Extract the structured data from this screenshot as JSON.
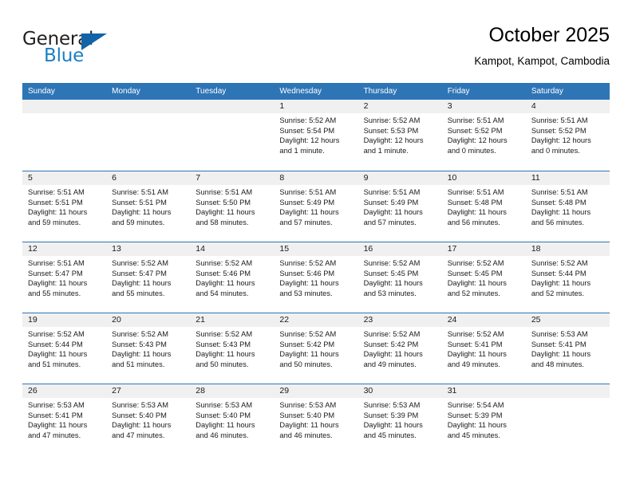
{
  "brand": {
    "name_part1": "General",
    "name_part2": "Blue",
    "triangle_icon": "blue-triangle-icon",
    "accent_color": "#1b7fc4"
  },
  "header": {
    "title": "October 2025",
    "subtitle": "Kampot, Kampot, Cambodia"
  },
  "theme": {
    "header_blue": "#2e75b6",
    "day_strip_gray": "#f0f0f0",
    "text_color": "#1a1a1a"
  },
  "calendar": {
    "weekdays": [
      "Sunday",
      "Monday",
      "Tuesday",
      "Wednesday",
      "Thursday",
      "Friday",
      "Saturday"
    ],
    "weeks": [
      [
        {
          "day": "",
          "empty": true
        },
        {
          "day": "",
          "empty": true
        },
        {
          "day": "",
          "empty": true
        },
        {
          "day": "1",
          "sunrise": "Sunrise: 5:52 AM",
          "sunset": "Sunset: 5:54 PM",
          "daylight_line1": "Daylight: 12 hours",
          "daylight_line2": "and 1 minute."
        },
        {
          "day": "2",
          "sunrise": "Sunrise: 5:52 AM",
          "sunset": "Sunset: 5:53 PM",
          "daylight_line1": "Daylight: 12 hours",
          "daylight_line2": "and 1 minute."
        },
        {
          "day": "3",
          "sunrise": "Sunrise: 5:51 AM",
          "sunset": "Sunset: 5:52 PM",
          "daylight_line1": "Daylight: 12 hours",
          "daylight_line2": "and 0 minutes."
        },
        {
          "day": "4",
          "sunrise": "Sunrise: 5:51 AM",
          "sunset": "Sunset: 5:52 PM",
          "daylight_line1": "Daylight: 12 hours",
          "daylight_line2": "and 0 minutes."
        }
      ],
      [
        {
          "day": "5",
          "sunrise": "Sunrise: 5:51 AM",
          "sunset": "Sunset: 5:51 PM",
          "daylight_line1": "Daylight: 11 hours",
          "daylight_line2": "and 59 minutes."
        },
        {
          "day": "6",
          "sunrise": "Sunrise: 5:51 AM",
          "sunset": "Sunset: 5:51 PM",
          "daylight_line1": "Daylight: 11 hours",
          "daylight_line2": "and 59 minutes."
        },
        {
          "day": "7",
          "sunrise": "Sunrise: 5:51 AM",
          "sunset": "Sunset: 5:50 PM",
          "daylight_line1": "Daylight: 11 hours",
          "daylight_line2": "and 58 minutes."
        },
        {
          "day": "8",
          "sunrise": "Sunrise: 5:51 AM",
          "sunset": "Sunset: 5:49 PM",
          "daylight_line1": "Daylight: 11 hours",
          "daylight_line2": "and 57 minutes."
        },
        {
          "day": "9",
          "sunrise": "Sunrise: 5:51 AM",
          "sunset": "Sunset: 5:49 PM",
          "daylight_line1": "Daylight: 11 hours",
          "daylight_line2": "and 57 minutes."
        },
        {
          "day": "10",
          "sunrise": "Sunrise: 5:51 AM",
          "sunset": "Sunset: 5:48 PM",
          "daylight_line1": "Daylight: 11 hours",
          "daylight_line2": "and 56 minutes."
        },
        {
          "day": "11",
          "sunrise": "Sunrise: 5:51 AM",
          "sunset": "Sunset: 5:48 PM",
          "daylight_line1": "Daylight: 11 hours",
          "daylight_line2": "and 56 minutes."
        }
      ],
      [
        {
          "day": "12",
          "sunrise": "Sunrise: 5:51 AM",
          "sunset": "Sunset: 5:47 PM",
          "daylight_line1": "Daylight: 11 hours",
          "daylight_line2": "and 55 minutes."
        },
        {
          "day": "13",
          "sunrise": "Sunrise: 5:52 AM",
          "sunset": "Sunset: 5:47 PM",
          "daylight_line1": "Daylight: 11 hours",
          "daylight_line2": "and 55 minutes."
        },
        {
          "day": "14",
          "sunrise": "Sunrise: 5:52 AM",
          "sunset": "Sunset: 5:46 PM",
          "daylight_line1": "Daylight: 11 hours",
          "daylight_line2": "and 54 minutes."
        },
        {
          "day": "15",
          "sunrise": "Sunrise: 5:52 AM",
          "sunset": "Sunset: 5:46 PM",
          "daylight_line1": "Daylight: 11 hours",
          "daylight_line2": "and 53 minutes."
        },
        {
          "day": "16",
          "sunrise": "Sunrise: 5:52 AM",
          "sunset": "Sunset: 5:45 PM",
          "daylight_line1": "Daylight: 11 hours",
          "daylight_line2": "and 53 minutes."
        },
        {
          "day": "17",
          "sunrise": "Sunrise: 5:52 AM",
          "sunset": "Sunset: 5:45 PM",
          "daylight_line1": "Daylight: 11 hours",
          "daylight_line2": "and 52 minutes."
        },
        {
          "day": "18",
          "sunrise": "Sunrise: 5:52 AM",
          "sunset": "Sunset: 5:44 PM",
          "daylight_line1": "Daylight: 11 hours",
          "daylight_line2": "and 52 minutes."
        }
      ],
      [
        {
          "day": "19",
          "sunrise": "Sunrise: 5:52 AM",
          "sunset": "Sunset: 5:44 PM",
          "daylight_line1": "Daylight: 11 hours",
          "daylight_line2": "and 51 minutes."
        },
        {
          "day": "20",
          "sunrise": "Sunrise: 5:52 AM",
          "sunset": "Sunset: 5:43 PM",
          "daylight_line1": "Daylight: 11 hours",
          "daylight_line2": "and 51 minutes."
        },
        {
          "day": "21",
          "sunrise": "Sunrise: 5:52 AM",
          "sunset": "Sunset: 5:43 PM",
          "daylight_line1": "Daylight: 11 hours",
          "daylight_line2": "and 50 minutes."
        },
        {
          "day": "22",
          "sunrise": "Sunrise: 5:52 AM",
          "sunset": "Sunset: 5:42 PM",
          "daylight_line1": "Daylight: 11 hours",
          "daylight_line2": "and 50 minutes."
        },
        {
          "day": "23",
          "sunrise": "Sunrise: 5:52 AM",
          "sunset": "Sunset: 5:42 PM",
          "daylight_line1": "Daylight: 11 hours",
          "daylight_line2": "and 49 minutes."
        },
        {
          "day": "24",
          "sunrise": "Sunrise: 5:52 AM",
          "sunset": "Sunset: 5:41 PM",
          "daylight_line1": "Daylight: 11 hours",
          "daylight_line2": "and 49 minutes."
        },
        {
          "day": "25",
          "sunrise": "Sunrise: 5:53 AM",
          "sunset": "Sunset: 5:41 PM",
          "daylight_line1": "Daylight: 11 hours",
          "daylight_line2": "and 48 minutes."
        }
      ],
      [
        {
          "day": "26",
          "sunrise": "Sunrise: 5:53 AM",
          "sunset": "Sunset: 5:41 PM",
          "daylight_line1": "Daylight: 11 hours",
          "daylight_line2": "and 47 minutes."
        },
        {
          "day": "27",
          "sunrise": "Sunrise: 5:53 AM",
          "sunset": "Sunset: 5:40 PM",
          "daylight_line1": "Daylight: 11 hours",
          "daylight_line2": "and 47 minutes."
        },
        {
          "day": "28",
          "sunrise": "Sunrise: 5:53 AM",
          "sunset": "Sunset: 5:40 PM",
          "daylight_line1": "Daylight: 11 hours",
          "daylight_line2": "and 46 minutes."
        },
        {
          "day": "29",
          "sunrise": "Sunrise: 5:53 AM",
          "sunset": "Sunset: 5:40 PM",
          "daylight_line1": "Daylight: 11 hours",
          "daylight_line2": "and 46 minutes."
        },
        {
          "day": "30",
          "sunrise": "Sunrise: 5:53 AM",
          "sunset": "Sunset: 5:39 PM",
          "daylight_line1": "Daylight: 11 hours",
          "daylight_line2": "and 45 minutes."
        },
        {
          "day": "31",
          "sunrise": "Sunrise: 5:54 AM",
          "sunset": "Sunset: 5:39 PM",
          "daylight_line1": "Daylight: 11 hours",
          "daylight_line2": "and 45 minutes."
        },
        {
          "day": "",
          "empty": true
        }
      ]
    ]
  }
}
